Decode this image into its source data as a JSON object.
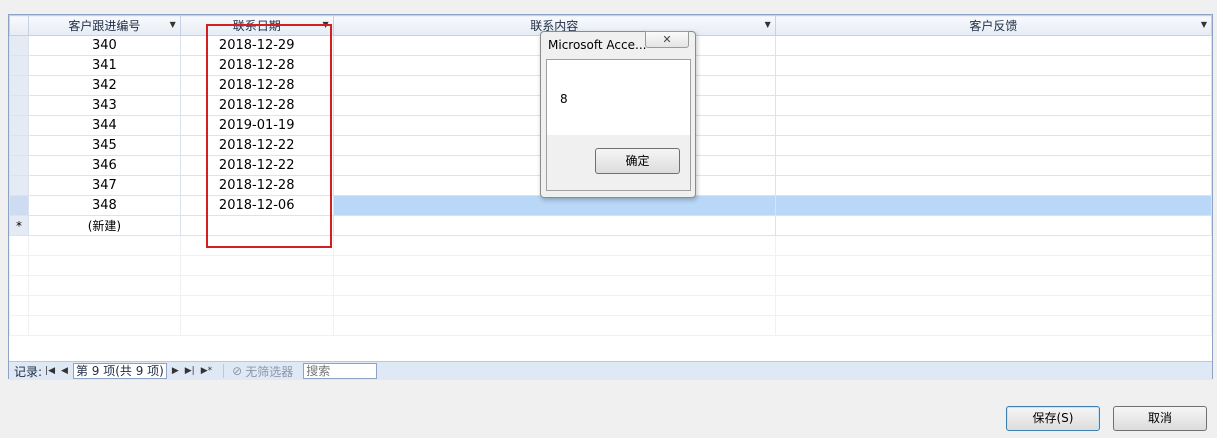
{
  "columns": [
    "客户跟进编号",
    "联系日期",
    "联系内容",
    "客户反馈"
  ],
  "rows": [
    {
      "id": "340",
      "date": "2018-12-29",
      "content": "",
      "feedback": ""
    },
    {
      "id": "341",
      "date": "2018-12-28",
      "content": "",
      "feedback": ""
    },
    {
      "id": "342",
      "date": "2018-12-28",
      "content": "",
      "feedback": ""
    },
    {
      "id": "343",
      "date": "2018-12-28",
      "content": "",
      "feedback": ""
    },
    {
      "id": "344",
      "date": "2019-01-19",
      "content": "",
      "feedback": ""
    },
    {
      "id": "345",
      "date": "2018-12-22",
      "content": "",
      "feedback": ""
    },
    {
      "id": "346",
      "date": "2018-12-22",
      "content": "",
      "feedback": ""
    },
    {
      "id": "347",
      "date": "2018-12-28",
      "content": "",
      "feedback": ""
    },
    {
      "id": "348",
      "date": "2018-12-06",
      "content": "",
      "feedback": ""
    }
  ],
  "new_row": {
    "marker": "*",
    "label": "(新建)"
  },
  "navbar": {
    "record_label": "记录:",
    "record_position": "第 9 项(共 9 项)",
    "no_filter_label": "无筛选器",
    "search_placeholder": "搜索"
  },
  "dialog": {
    "title": "Microsoft Acce...",
    "close_glyph": "✕",
    "message": "8",
    "ok_label": "确定"
  },
  "buttons": {
    "save_label": "保存(S)",
    "cancel_label": "取消"
  }
}
